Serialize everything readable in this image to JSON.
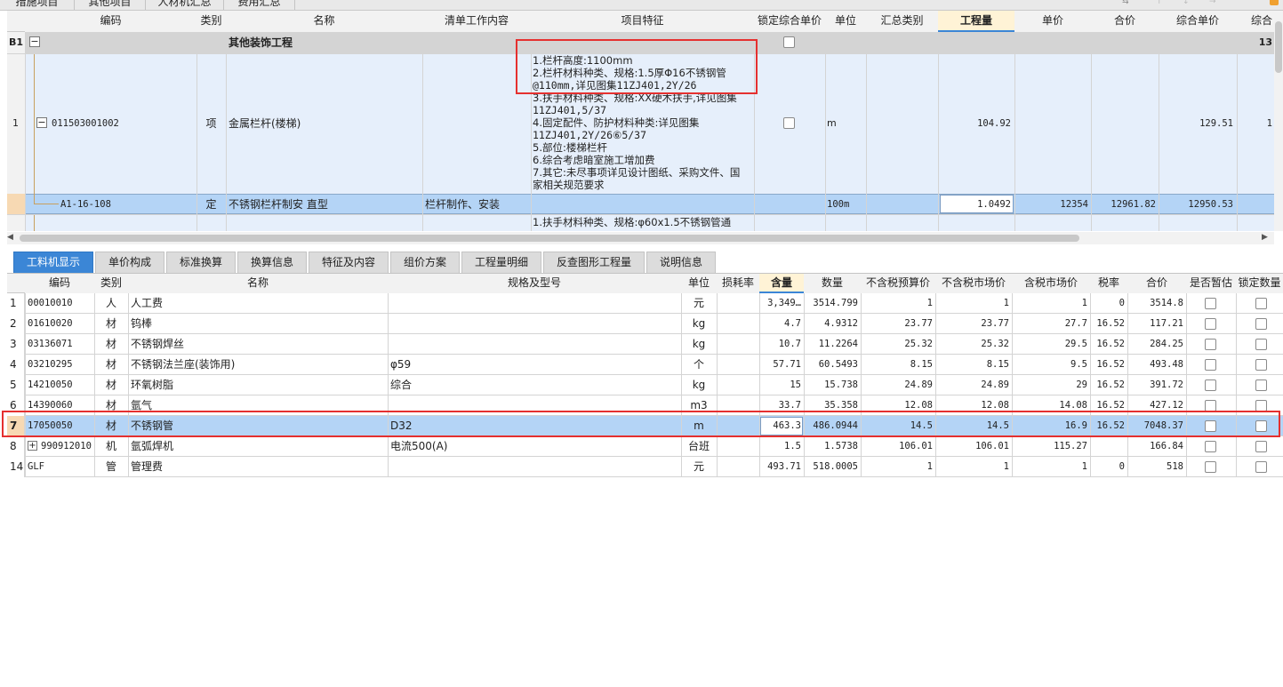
{
  "top_tabs": [
    "措施项目",
    "其他项目",
    "人材机汇总",
    "费用汇总"
  ],
  "upper_table": {
    "headers": [
      "编码",
      "类别",
      "名称",
      "清单工作内容",
      "项目特征",
      "锁定综合单价",
      "单位",
      "汇总类别",
      "工程量",
      "单价",
      "合价",
      "综合单价",
      "综合"
    ],
    "section_row": {
      "idx": "B1",
      "name": "其他装饰工程",
      "total_partial": "13"
    },
    "item_row": {
      "idx": "1",
      "code": "011503001002",
      "type": "项",
      "name": "金属栏杆(楼梯)",
      "features": [
        "1.栏杆高度:1100mm",
        "2.栏杆材料种类、规格:1.5厚Φ16不锈钢管",
        "@110mm,详见图集11ZJ401,2Y/26",
        "3.扶手材料种类、规格:XX硬木扶手,详见图集",
        "11ZJ401,5/37",
        "4.固定配件、防护材料种类:详见图集",
        "11ZJ401,2Y/26⑥5/37",
        "5.部位:楼梯栏杆",
        "6.综合考虑暗室施工增加费",
        "7.其它:未尽事项详见设计图纸、采购文件、国",
        "家相关规范要求"
      ],
      "unit": "m",
      "quantity": "104.92",
      "composite_price": "129.51",
      "composite_partial": "1"
    },
    "sub_row": {
      "code": "A1-16-108",
      "type": "定",
      "name": "不锈钢栏杆制安 直型",
      "work": "栏杆制作、安装",
      "unit": "100m",
      "quantity": "1.0492",
      "price": "12354",
      "total": "12961.82",
      "composite_price": "12950.53"
    },
    "partial_row": {
      "feature": "1.扶手材料种类、规格:φ60x1.5不锈钢管通"
    }
  },
  "bottom_tabs": [
    "工料机显示",
    "单价构成",
    "标准换算",
    "换算信息",
    "特征及内容",
    "组价方案",
    "工程量明细",
    "反查图形工程量",
    "说明信息"
  ],
  "lower_table": {
    "headers": [
      "编码",
      "类别",
      "名称",
      "规格及型号",
      "单位",
      "损耗率",
      "含量",
      "数量",
      "不含税预算价",
      "不含税市场价",
      "含税市场价",
      "税率",
      "合价",
      "是否暂估",
      "锁定数量"
    ],
    "rows": [
      {
        "idx": "1",
        "code": "00010010",
        "type": "人",
        "name": "人工费",
        "spec": "",
        "unit": "元",
        "loss": "",
        "content": "3,349…",
        "qty": "3514.799",
        "pre": "1",
        "mkt": "1",
        "mkt_tax": "1",
        "rate": "0",
        "total": "3514.8"
      },
      {
        "idx": "2",
        "code": "01610020",
        "type": "材",
        "name": "钨棒",
        "spec": "",
        "unit": "kg",
        "loss": "",
        "content": "4.7",
        "qty": "4.9312",
        "pre": "23.77",
        "mkt": "23.77",
        "mkt_tax": "27.7",
        "rate": "16.52",
        "total": "117.21"
      },
      {
        "idx": "3",
        "code": "03136071",
        "type": "材",
        "name": "不锈钢焊丝",
        "spec": "",
        "unit": "kg",
        "loss": "",
        "content": "10.7",
        "qty": "11.2264",
        "pre": "25.32",
        "mkt": "25.32",
        "mkt_tax": "29.5",
        "rate": "16.52",
        "total": "284.25"
      },
      {
        "idx": "4",
        "code": "03210295",
        "type": "材",
        "name": "不锈钢法兰座(装饰用)",
        "spec": "φ59",
        "unit": "个",
        "loss": "",
        "content": "57.71",
        "qty": "60.5493",
        "pre": "8.15",
        "mkt": "8.15",
        "mkt_tax": "9.5",
        "rate": "16.52",
        "total": "493.48"
      },
      {
        "idx": "5",
        "code": "14210050",
        "type": "材",
        "name": "环氧树脂",
        "spec": "综合",
        "unit": "kg",
        "loss": "",
        "content": "15",
        "qty": "15.738",
        "pre": "24.89",
        "mkt": "24.89",
        "mkt_tax": "29",
        "rate": "16.52",
        "total": "391.72"
      },
      {
        "idx": "6",
        "code": "14390060",
        "type": "材",
        "name": "氩气",
        "spec": "",
        "unit": "m3",
        "loss": "",
        "content": "33.7",
        "qty": "35.358",
        "pre": "12.08",
        "mkt": "12.08",
        "mkt_tax": "14.08",
        "rate": "16.52",
        "total": "427.12"
      },
      {
        "idx": "7",
        "code": "17050050",
        "type": "材",
        "name": "不锈钢管",
        "spec": "D32",
        "unit": "m",
        "loss": "",
        "content": "463.3",
        "qty": "486.0944",
        "pre": "14.5",
        "mkt": "14.5",
        "mkt_tax": "16.9",
        "rate": "16.52",
        "total": "7048.37"
      },
      {
        "idx": "8",
        "code": "990912010",
        "type": "机",
        "name": "氩弧焊机",
        "spec": "电流500(A)",
        "unit": "台班",
        "loss": "",
        "content": "1.5",
        "qty": "1.5738",
        "pre": "106.01",
        "mkt": "106.01",
        "mkt_tax": "115.27",
        "rate": "",
        "total": "166.84"
      },
      {
        "idx": "14",
        "code": "GLF",
        "type": "管",
        "name": "管理费",
        "spec": "",
        "unit": "元",
        "loss": "",
        "content": "493.71",
        "qty": "518.0005",
        "pre": "1",
        "mkt": "1",
        "mkt_tax": "1",
        "rate": "0",
        "total": "518"
      }
    ]
  },
  "colors": {
    "accent": "#3b86d6",
    "highlight": "#e5302f",
    "row_selected": "#b4d4f6",
    "row_light": "#e6effb"
  }
}
